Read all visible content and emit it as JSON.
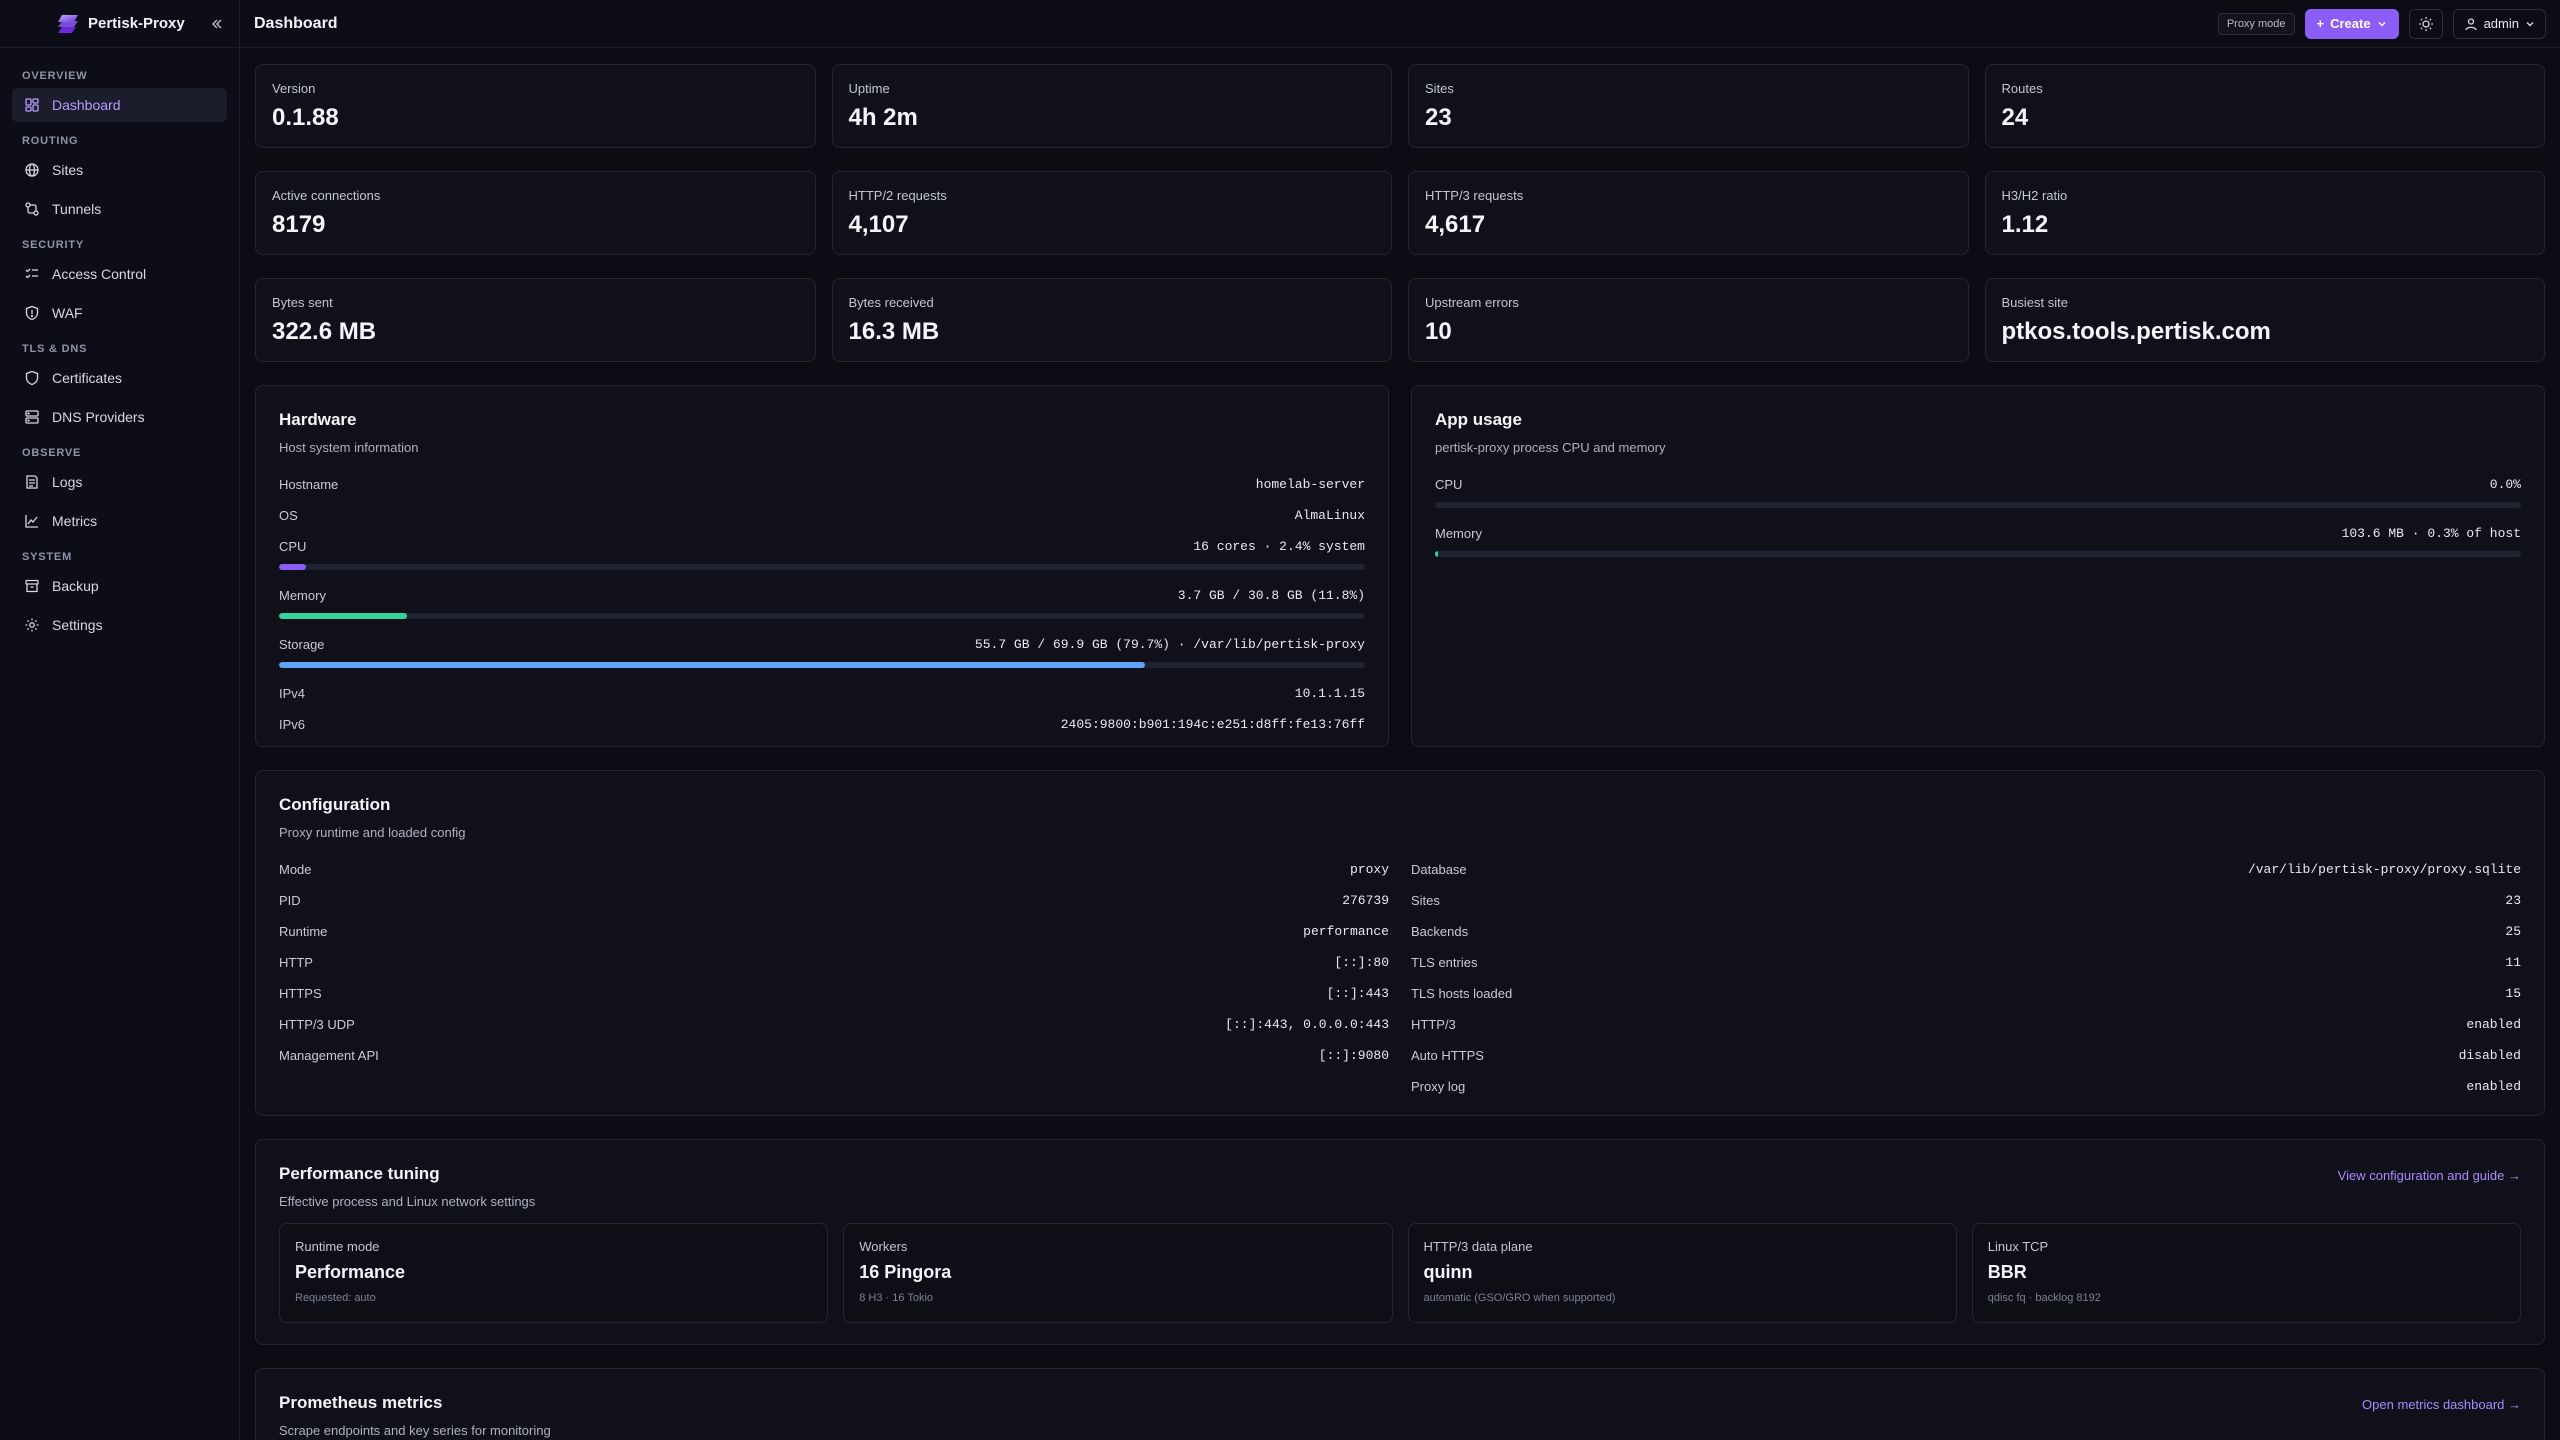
{
  "app": {
    "name": "Pertisk-Proxy",
    "collapse_icon": "double-chevron-left-icon"
  },
  "sidebar": {
    "sections": [
      {
        "title": "OVERVIEW",
        "items": [
          {
            "label": "Dashboard",
            "icon": "dashboard-icon",
            "active": true
          }
        ]
      },
      {
        "title": "ROUTING",
        "items": [
          {
            "label": "Sites",
            "icon": "globe-icon"
          },
          {
            "label": "Tunnels",
            "icon": "tunnel-icon"
          }
        ]
      },
      {
        "title": "SECURITY",
        "items": [
          {
            "label": "Access Control",
            "icon": "list-check-icon"
          },
          {
            "label": "WAF",
            "icon": "shield-icon"
          }
        ]
      },
      {
        "title": "TLS & DNS",
        "items": [
          {
            "label": "Certificates",
            "icon": "certificate-shield-icon"
          },
          {
            "label": "DNS Providers",
            "icon": "server-icon"
          }
        ]
      },
      {
        "title": "OBSERVE",
        "items": [
          {
            "label": "Logs",
            "icon": "logs-icon"
          },
          {
            "label": "Metrics",
            "icon": "chart-line-icon"
          }
        ]
      },
      {
        "title": "SYSTEM",
        "items": [
          {
            "label": "Backup",
            "icon": "archive-icon"
          },
          {
            "label": "Settings",
            "icon": "gear-icon"
          }
        ]
      }
    ]
  },
  "topbar": {
    "title": "Dashboard",
    "mode_badge": "Proxy mode",
    "create_label": "Create",
    "user_label": "admin"
  },
  "stats": [
    [
      {
        "label": "Version",
        "value": "0.1.88"
      },
      {
        "label": "Uptime",
        "value": "4h 2m"
      },
      {
        "label": "Sites",
        "value": "23"
      },
      {
        "label": "Routes",
        "value": "24"
      }
    ],
    [
      {
        "label": "Active connections",
        "value": "8179"
      },
      {
        "label": "HTTP/2 requests",
        "value": "4,107"
      },
      {
        "label": "HTTP/3 requests",
        "value": "4,617"
      },
      {
        "label": "H3/H2 ratio",
        "value": "1.12"
      }
    ],
    [
      {
        "label": "Bytes sent",
        "value": "322.6 MB"
      },
      {
        "label": "Bytes received",
        "value": "16.3 MB"
      },
      {
        "label": "Upstream errors",
        "value": "10"
      },
      {
        "label": "Busiest site",
        "value": "ptkos.tools.pertisk.com"
      }
    ]
  ],
  "hardware": {
    "title": "Hardware",
    "subtitle": "Host system information",
    "hostname_label": "Hostname",
    "hostname": "homelab-server",
    "os_label": "OS",
    "os": "AlmaLinux",
    "cpu_label": "CPU",
    "cpu": "16 cores · 2.4% system",
    "cpu_fraction": 0.024,
    "cpu_color": "#8b5cf6",
    "memory_label": "Memory",
    "memory": "3.7 GB / 30.8 GB (11.8%)",
    "memory_fraction": 0.118,
    "memory_color": "#34d399",
    "storage_label": "Storage",
    "storage": "55.7 GB / 69.9 GB (79.7%) · /var/lib/pertisk-proxy",
    "storage_fraction": 0.797,
    "storage_color": "#60a5fa",
    "ipv4_label": "IPv4",
    "ipv4": "10.1.1.15",
    "ipv6_label": "IPv6",
    "ipv6": "2405:9800:b901:194c:e251:d8ff:fe13:76ff"
  },
  "app_usage": {
    "title": "App usage",
    "subtitle": "pertisk-proxy process CPU and memory",
    "cpu_label": "CPU",
    "cpu": "0.0%",
    "cpu_fraction": 0.0,
    "memory_label": "Memory",
    "memory": "103.6 MB · 0.3% of host",
    "memory_fraction": 0.003,
    "memory_color": "#34d399"
  },
  "configuration": {
    "title": "Configuration",
    "subtitle": "Proxy runtime and loaded config",
    "left": [
      {
        "label": "Mode",
        "value": "proxy"
      },
      {
        "label": "PID",
        "value": "276739"
      },
      {
        "label": "Runtime",
        "value": "performance"
      },
      {
        "label": "HTTP",
        "value": "[::]:80"
      },
      {
        "label": "HTTPS",
        "value": "[::]:443"
      },
      {
        "label": "HTTP/3 UDP",
        "value": "[::]:443, 0.0.0.0:443"
      },
      {
        "label": "Management API",
        "value": "[::]:9080"
      }
    ],
    "right": [
      {
        "label": "Database",
        "value": "/var/lib/pertisk-proxy/proxy.sqlite"
      },
      {
        "label": "Sites",
        "value": "23"
      },
      {
        "label": "Backends",
        "value": "25"
      },
      {
        "label": "TLS entries",
        "value": "11"
      },
      {
        "label": "TLS hosts loaded",
        "value": "15"
      },
      {
        "label": "HTTP/3",
        "value": "enabled"
      },
      {
        "label": "Auto HTTPS",
        "value": "disabled"
      },
      {
        "label": "Proxy log",
        "value": "enabled"
      }
    ]
  },
  "performance": {
    "title": "Performance tuning",
    "subtitle": "Effective process and Linux network settings",
    "link": "View configuration and guide →",
    "tiles": [
      {
        "label": "Runtime mode",
        "value": "Performance",
        "note": "Requested: auto"
      },
      {
        "label": "Workers",
        "value": "16 Pingora",
        "note": "8 H3 · 16 Tokio"
      },
      {
        "label": "HTTP/3 data plane",
        "value": "quinn",
        "note": "automatic (GSO/GRO when supported)"
      },
      {
        "label": "Linux TCP",
        "value": "BBR",
        "note": "qdisc fq · backlog 8192"
      }
    ]
  },
  "prometheus": {
    "title": "Prometheus metrics",
    "subtitle": "Scrape endpoints and key series for monitoring",
    "link": "Open metrics dashboard →"
  }
}
